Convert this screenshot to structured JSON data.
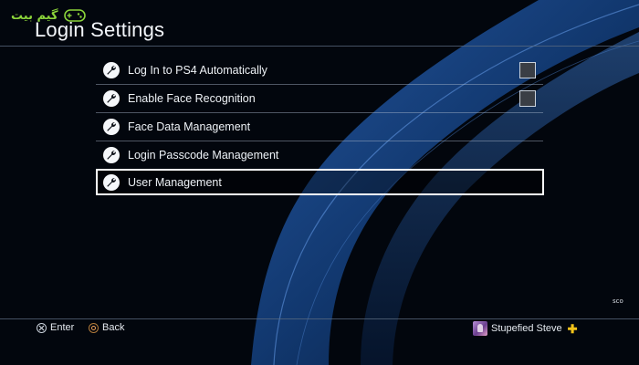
{
  "watermark": {
    "text": "گیم بیت",
    "icon": "gamepad-icon",
    "color": "#8bd43a"
  },
  "header": {
    "title": "Login Settings"
  },
  "settings": {
    "items": [
      {
        "label": "Log In to PS4 Automatically",
        "icon": "wrench-icon",
        "has_checkbox": true,
        "checked": false
      },
      {
        "label": "Enable Face Recognition",
        "icon": "wrench-icon",
        "has_checkbox": true,
        "checked": false
      },
      {
        "label": "Face Data Management",
        "icon": "wrench-icon",
        "has_checkbox": false
      },
      {
        "label": "Login Passcode Management",
        "icon": "wrench-icon",
        "has_checkbox": false
      },
      {
        "label": "User Management",
        "icon": "wrench-icon",
        "has_checkbox": false,
        "selected": true
      }
    ]
  },
  "corner_tag": "sco",
  "footer": {
    "enter_label": "Enter",
    "back_label": "Back",
    "enter_icon": "cross-button-icon",
    "back_icon": "circle-button-icon",
    "user_name": "Stupefied Steve",
    "plus_icon": "playstation-plus-icon",
    "plus_color": "#f2c31a"
  },
  "colors": {
    "background": "#02060d",
    "wave": "#1f4f9a",
    "selection_border": "#ffffff"
  }
}
